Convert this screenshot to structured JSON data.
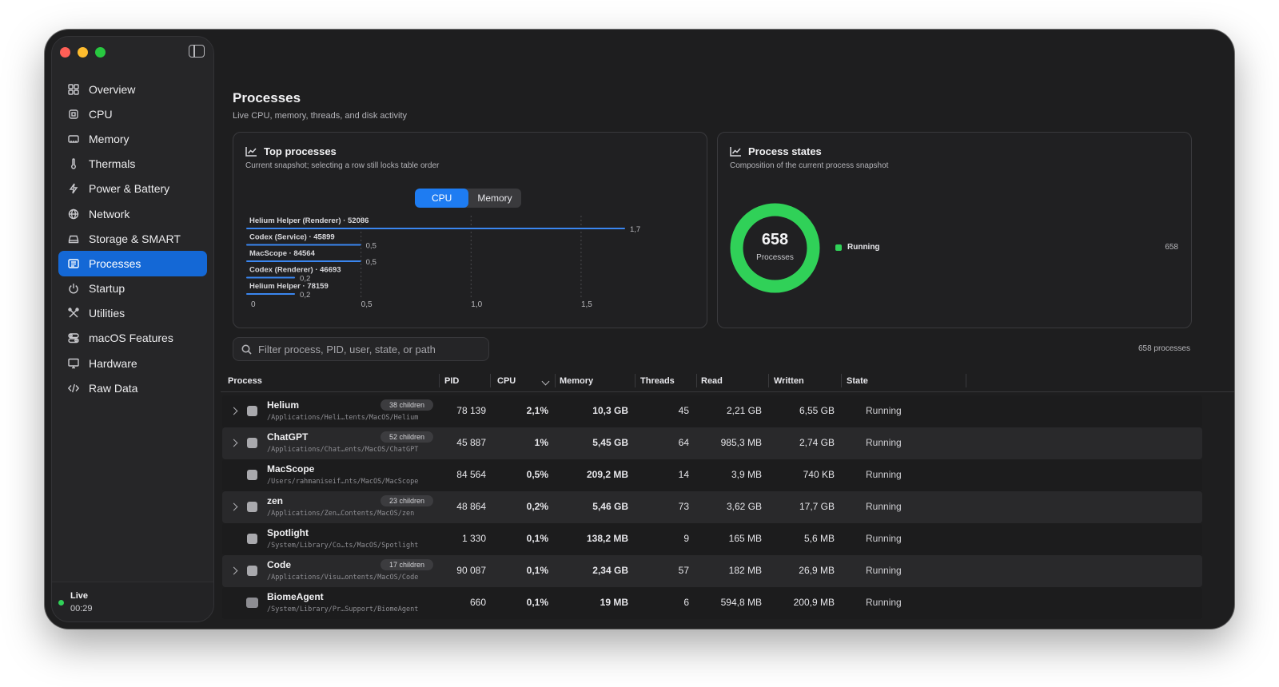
{
  "sidebar": {
    "items": [
      {
        "label": "Overview"
      },
      {
        "label": "CPU"
      },
      {
        "label": "Memory"
      },
      {
        "label": "Thermals"
      },
      {
        "label": "Power & Battery"
      },
      {
        "label": "Network"
      },
      {
        "label": "Storage & SMART"
      },
      {
        "label": "Processes"
      },
      {
        "label": "Startup"
      },
      {
        "label": "Utilities"
      },
      {
        "label": "macOS Features"
      },
      {
        "label": "Hardware"
      },
      {
        "label": "Raw Data"
      }
    ],
    "active_item": "Processes",
    "live_label": "Live",
    "live_time": "00:29"
  },
  "page": {
    "title": "Processes",
    "subtitle": "Live CPU, memory, threads, and disk activity"
  },
  "top_processes": {
    "title": "Top processes",
    "subtitle": "Current snapshot; selecting a row still locks table order",
    "segments": [
      "CPU",
      "Memory"
    ],
    "selected_segment": "CPU"
  },
  "chart_data": {
    "type": "bar",
    "orientation": "horizontal",
    "categories": [
      "Helium Helper (Renderer) · 52086",
      "Codex (Service) · 45899",
      "MacScope · 84564",
      "Codex (Renderer) · 46693",
      "Helium Helper · 78159"
    ],
    "values": [
      1.7,
      0.5,
      0.5,
      0.2,
      0.2
    ],
    "value_labels": [
      "1,7",
      "0,5",
      "0,5",
      "0,2",
      "0,2"
    ],
    "xlim": [
      0,
      1.7
    ],
    "x_ticks": [
      0,
      0.5,
      1.0,
      1.5
    ],
    "x_tick_labels": [
      "0",
      "0,5",
      "1,0",
      "1,5"
    ],
    "grid": true,
    "bar_color": "#3a86f0"
  },
  "process_states": {
    "title": "Process states",
    "subtitle": "Composition of the current process snapshot",
    "total": "658",
    "total_label": "Processes",
    "legend": [
      {
        "label": "Running",
        "value": "658",
        "color": "#30d158"
      }
    ]
  },
  "search": {
    "placeholder": "Filter process, PID, user, state, or path"
  },
  "process_count": "658 processes",
  "table": {
    "columns": [
      "Process",
      "PID",
      "CPU",
      "Memory",
      "Threads",
      "Read",
      "Written",
      "State"
    ],
    "rows": [
      {
        "name": "Helium",
        "path": "/Applications/Heli…tents/MacOS/Helium",
        "children": "38 children",
        "pid": "78 139",
        "cpu": "2,1%",
        "memory": "10,3 GB",
        "threads": "45",
        "read": "2,21 GB",
        "written": "6,55 GB",
        "state": "Running"
      },
      {
        "name": "ChatGPT",
        "path": "/Applications/Chat…ents/MacOS/ChatGPT",
        "children": "52 children",
        "pid": "45 887",
        "cpu": "1%",
        "memory": "5,45 GB",
        "threads": "64",
        "read": "985,3 MB",
        "written": "2,74 GB",
        "state": "Running"
      },
      {
        "name": "MacScope",
        "path": "/Users/rahmaniseif…nts/MacOS/MacScope",
        "children": "",
        "pid": "84 564",
        "cpu": "0,5%",
        "memory": "209,2 MB",
        "threads": "14",
        "read": "3,9 MB",
        "written": "740 KB",
        "state": "Running"
      },
      {
        "name": "zen",
        "path": "/Applications/Zen…Contents/MacOS/zen",
        "children": "23 children",
        "pid": "48 864",
        "cpu": "0,2%",
        "memory": "5,46 GB",
        "threads": "73",
        "read": "3,62 GB",
        "written": "17,7 GB",
        "state": "Running"
      },
      {
        "name": "Spotlight",
        "path": "/System/Library/Co…ts/MacOS/Spotlight",
        "children": "",
        "pid": "1 330",
        "cpu": "0,1%",
        "memory": "138,2 MB",
        "threads": "9",
        "read": "165 MB",
        "written": "5,6 MB",
        "state": "Running"
      },
      {
        "name": "Code",
        "path": "/Applications/Visu…ontents/MacOS/Code",
        "children": "17 children",
        "pid": "90 087",
        "cpu": "0,1%",
        "memory": "2,34 GB",
        "threads": "57",
        "read": "182 MB",
        "written": "26,9 MB",
        "state": "Running"
      },
      {
        "name": "BiomeAgent",
        "path": "/System/Library/Pr…Support/BiomeAgent",
        "children": "",
        "pid": "660",
        "cpu": "0,1%",
        "memory": "19 MB",
        "threads": "6",
        "read": "594,8 MB",
        "written": "200,9 MB",
        "state": "Running"
      }
    ]
  }
}
